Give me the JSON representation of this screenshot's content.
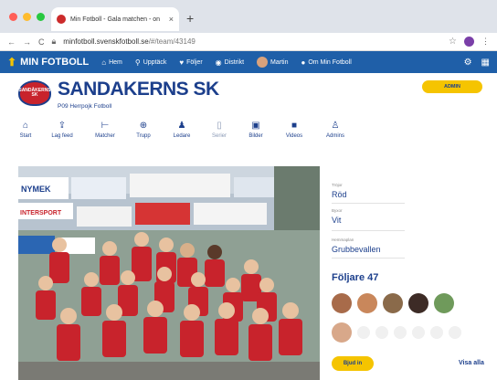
{
  "browser": {
    "tab_title": "Min Fotboll - Gala matchen - on",
    "tab_close": "×",
    "new_tab": "+",
    "url_host": "minfotboll.svenskfotboll.se",
    "url_path": "/#/team/43149",
    "back_icon": "←",
    "forward_icon": "→",
    "reload_icon": "C"
  },
  "navbar": {
    "brand": "MIN FOTBOLL",
    "items": [
      {
        "icon": "home-icon",
        "glyph": "⌂",
        "label": "Hem"
      },
      {
        "icon": "search-icon",
        "glyph": "⚲",
        "label": "Upptäck"
      },
      {
        "icon": "heart-icon",
        "glyph": "♥",
        "label": "Följer"
      },
      {
        "icon": "district-icon",
        "glyph": "◉",
        "label": "Distrikt"
      },
      {
        "icon": "user-avatar-icon",
        "glyph": "",
        "label": "Martin"
      },
      {
        "icon": "info-icon",
        "glyph": "●",
        "label": "Om Min Fotboll"
      }
    ]
  },
  "team": {
    "name": "SANDAKERNS SK",
    "subtitle": "P09   Herrpojk   Fotboll",
    "crest_text": "SANDÅKERNS SK",
    "admin_button": "ADMIN"
  },
  "tabs": [
    {
      "glyph": "⌂",
      "label": "Start",
      "icon": "home-icon"
    },
    {
      "glyph": "↥",
      "label": "Lag feed",
      "icon": "feed-icon"
    },
    {
      "glyph": "⊢",
      "label": "Matcher",
      "icon": "matches-icon"
    },
    {
      "glyph": "⊕",
      "label": "Trupp",
      "icon": "squad-icon"
    },
    {
      "glyph": "♟",
      "label": "Ledare",
      "icon": "leaders-icon"
    },
    {
      "glyph": "▯",
      "label": "Serier",
      "icon": "series-icon"
    },
    {
      "glyph": "▣",
      "label": "Bilder",
      "icon": "photos-icon"
    },
    {
      "glyph": "■",
      "label": "Videos",
      "icon": "videos-icon"
    },
    {
      "glyph": "♙",
      "label": "Admins",
      "icon": "admins-icon"
    }
  ],
  "sidebar": {
    "fields": [
      {
        "label": "Tröjor",
        "value": "Röd"
      },
      {
        "label": "Byxor",
        "value": "Vit"
      },
      {
        "label": "Hemmaplan",
        "value": "Grubbevallen"
      }
    ],
    "followers_title": "Följare 47",
    "join_button": "Bjud in",
    "view_all": "Visa alla"
  },
  "photo": {
    "banners": [
      "NYMEK",
      "INTERSPORT"
    ]
  },
  "colors": {
    "brand_blue": "#1f5fa8",
    "navy": "#1c3f8c",
    "accent_yellow": "#f5c400",
    "jersey_red": "#c8232c"
  }
}
